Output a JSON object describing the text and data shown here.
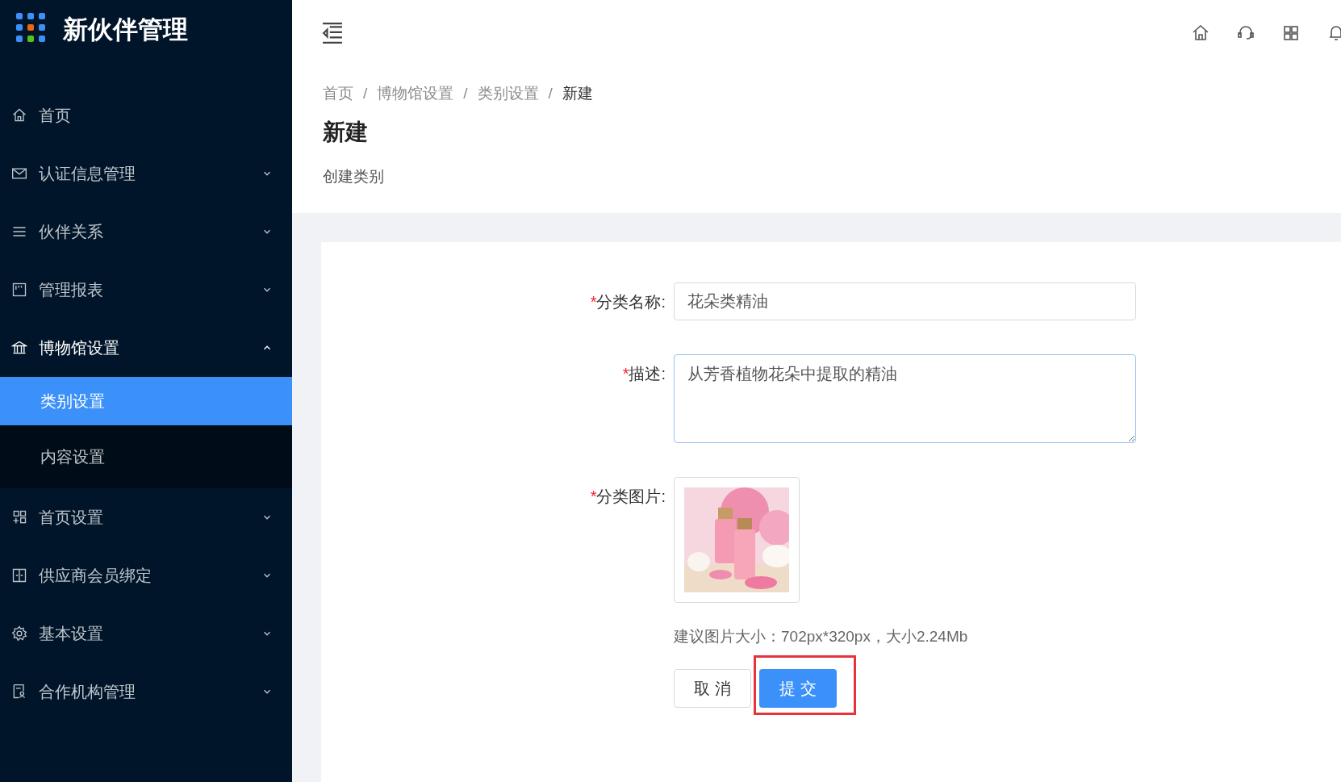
{
  "app": {
    "title": "新伙伴管理"
  },
  "sidebar": {
    "items": [
      {
        "label": "首页",
        "kind": "link",
        "expanded": false
      },
      {
        "label": "认证信息管理",
        "kind": "submenu",
        "expanded": false
      },
      {
        "label": "伙伴关系",
        "kind": "submenu",
        "expanded": false
      },
      {
        "label": "管理报表",
        "kind": "submenu",
        "expanded": false
      },
      {
        "label": "博物馆设置",
        "kind": "submenu",
        "expanded": true,
        "children": [
          {
            "label": "类别设置",
            "selected": true
          },
          {
            "label": "内容设置",
            "selected": false
          }
        ]
      },
      {
        "label": "首页设置",
        "kind": "submenu",
        "expanded": false
      },
      {
        "label": "供应商会员绑定",
        "kind": "submenu",
        "expanded": false
      },
      {
        "label": "基本设置",
        "kind": "submenu",
        "expanded": false
      },
      {
        "label": "合作机构管理",
        "kind": "submenu",
        "expanded": false
      }
    ]
  },
  "breadcrumb": [
    "首页",
    "博物馆设置",
    "类别设置",
    "新建"
  ],
  "breadcrumb_separator": "/",
  "page": {
    "title": "新建",
    "subtitle": "创建类别"
  },
  "form": {
    "fields": [
      {
        "kind": "input",
        "label": "分类名称:",
        "required_mark": "*",
        "value": "花朵类精油"
      },
      {
        "kind": "textarea",
        "label": "描述:",
        "required_mark": "*",
        "value": "从芳香植物花朵中提取的精油"
      },
      {
        "label": "分类图片:",
        "required_mark": "*",
        "hint": "建议图片大小：702px*320px，大小2.24Mb"
      }
    ],
    "buttons": [
      {
        "label": "取 消",
        "kind": "secondary",
        "highlighted": false
      },
      {
        "label": "提 交",
        "kind": "primary",
        "highlighted": true
      }
    ]
  }
}
